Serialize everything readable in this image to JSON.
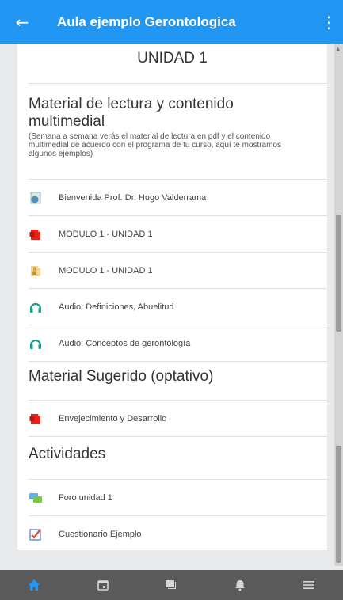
{
  "appbar": {
    "title": "Aula ejemplo Gerontologica",
    "back_icon": "arrow-left-icon",
    "menu_icon": "more-vertical-icon"
  },
  "unit": {
    "title": "UNIDAD 1"
  },
  "sections": {
    "lectura": {
      "heading": "Material de lectura y contenido multimedial",
      "description": "(Semana a semana verás el material de lectura en pdf y el contenido multimedial de acuerdo con el programa de tu curso, aquí te mostramos algunos ejemplos)",
      "items": [
        {
          "label": "Bienvenida Prof. Dr. Hugo Valderrama",
          "icon": "web-page-icon"
        },
        {
          "label": "MODULO 1 - UNIDAD 1",
          "icon": "pdf-file-icon"
        },
        {
          "label": "MODULO 1 - UNIDAD 1",
          "icon": "archive-file-icon"
        },
        {
          "label": "Audio: Definiciones, Abuelitud",
          "icon": "audio-icon"
        },
        {
          "label": "Audio: Conceptos de gerontología",
          "icon": "audio-icon"
        }
      ]
    },
    "sugerido": {
      "heading": "Material Sugerido (optativo)",
      "items": [
        {
          "label": "Envejecimiento y Desarrollo",
          "icon": "pdf-file-icon"
        }
      ]
    },
    "actividades": {
      "heading": "Actividades",
      "items": [
        {
          "label": "Foro unidad 1",
          "icon": "forum-icon"
        },
        {
          "label": "Cuestionario Ejemplo",
          "icon": "quiz-icon"
        }
      ]
    }
  },
  "bottom_nav": [
    {
      "icon": "home-icon",
      "active": true
    },
    {
      "icon": "calendar-icon",
      "active": false
    },
    {
      "icon": "messages-icon",
      "active": false
    },
    {
      "icon": "notifications-icon",
      "active": false
    },
    {
      "icon": "menu-icon",
      "active": false
    }
  ],
  "colors": {
    "primary": "#2196f3",
    "bottom_bar": "#5a5a5a",
    "active_nav": "#2196f3",
    "inactive_nav": "#d8d8d8"
  }
}
